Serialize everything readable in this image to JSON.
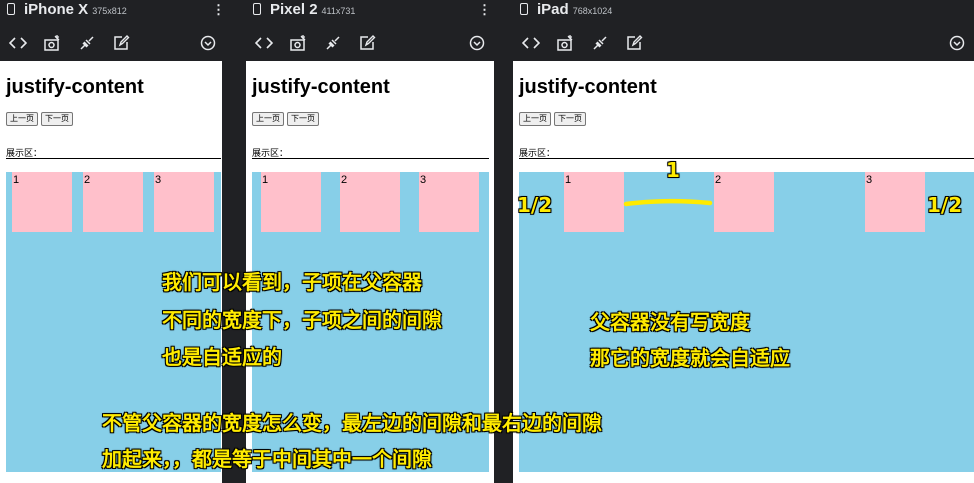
{
  "devices": [
    {
      "name": "iPhone X",
      "size": "375x812",
      "boxes": [
        "1",
        "2",
        "3"
      ]
    },
    {
      "name": "Pixel 2",
      "size": "411x731",
      "boxes": [
        "1",
        "2",
        "3"
      ]
    },
    {
      "name": "iPad",
      "size": "768x1024",
      "boxes": [
        "1",
        "2",
        "3"
      ]
    }
  ],
  "page": {
    "title": "justify-content",
    "prev_button": "上一页",
    "next_button": "下一页",
    "display_label": "展示区："
  },
  "toolbar_icons": [
    "code-icon",
    "camera-icon",
    "plug-icon",
    "edit-icon",
    "refresh-icon"
  ],
  "annotations": {
    "gap_one": "1",
    "gap_half_left": "1/2",
    "gap_half_right": "1/2",
    "note1": [
      "我们可以看到，子项在父容器",
      "不同的宽度下，子项之间的间隙",
      "也是自适应的"
    ],
    "note2": [
      "父容器没有写宽度",
      "那它的宽度就会自适应"
    ],
    "note3": [
      "不管父容器的宽度怎么变，最左边的间隙和最右边的间隙",
      "加起来，，都是等于中间其中一个间隙"
    ]
  },
  "colors": {
    "stage": "#87cfe8",
    "box": "#ffc0cb",
    "annotation": "#ffeb00",
    "chrome": "#202124"
  }
}
